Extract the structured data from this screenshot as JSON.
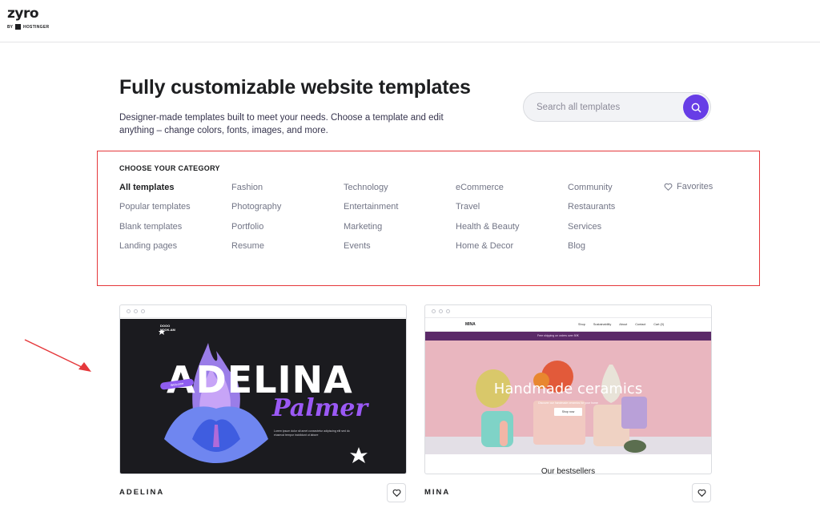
{
  "logo": {
    "wordmark": "zyro",
    "by": "BY",
    "parent": "HOSTINGER"
  },
  "header": {
    "title": "Fully customizable website templates",
    "description": "Designer-made templates built to meet your needs. Choose a template and edit anything – change colors, fonts, images, and more."
  },
  "search": {
    "placeholder": "Search all templates",
    "value": ""
  },
  "categories": {
    "heading": "CHOOSE YOUR CATEGORY",
    "columns": [
      [
        "All templates",
        "Popular templates",
        "Blank templates",
        "Landing pages"
      ],
      [
        "Fashion",
        "Photography",
        "Portfolio",
        "Resume"
      ],
      [
        "Technology",
        "Entertainment",
        "Marketing",
        "Events"
      ],
      [
        "eCommerce",
        "Travel",
        "Health & Beauty",
        "Home & Decor"
      ],
      [
        "Community",
        "Restaurants",
        "Services",
        "Blog"
      ]
    ],
    "active": "All templates",
    "favorites": "Favorites"
  },
  "templates": [
    {
      "name": "ADELINA",
      "preview": {
        "logo_line1": "DOOO",
        "logo_line2": "LOOK.AM",
        "headline": "ADELINA",
        "script": "Palmer",
        "tag": "Welcome",
        "body": "Lorem ipsum dolor sit amet consectetur adipiscing elit sed do eiusmod tempor incididunt ut labore"
      }
    },
    {
      "name": "MINA",
      "preview": {
        "logo": "MINA",
        "nav": [
          "Shop",
          "Sustainability",
          "About",
          "Contact",
          "Cart (0)"
        ],
        "banner": "Free shipping on orders over 50€",
        "headline": "Handmade ceramics",
        "subline": "Discover our handmade ceramics for your home",
        "cta": "Shop now",
        "section": "Our bestsellers"
      }
    }
  ],
  "colors": {
    "accent": "#673de6",
    "highlight_box": "#e5383b",
    "arrow": "#e5383b"
  }
}
